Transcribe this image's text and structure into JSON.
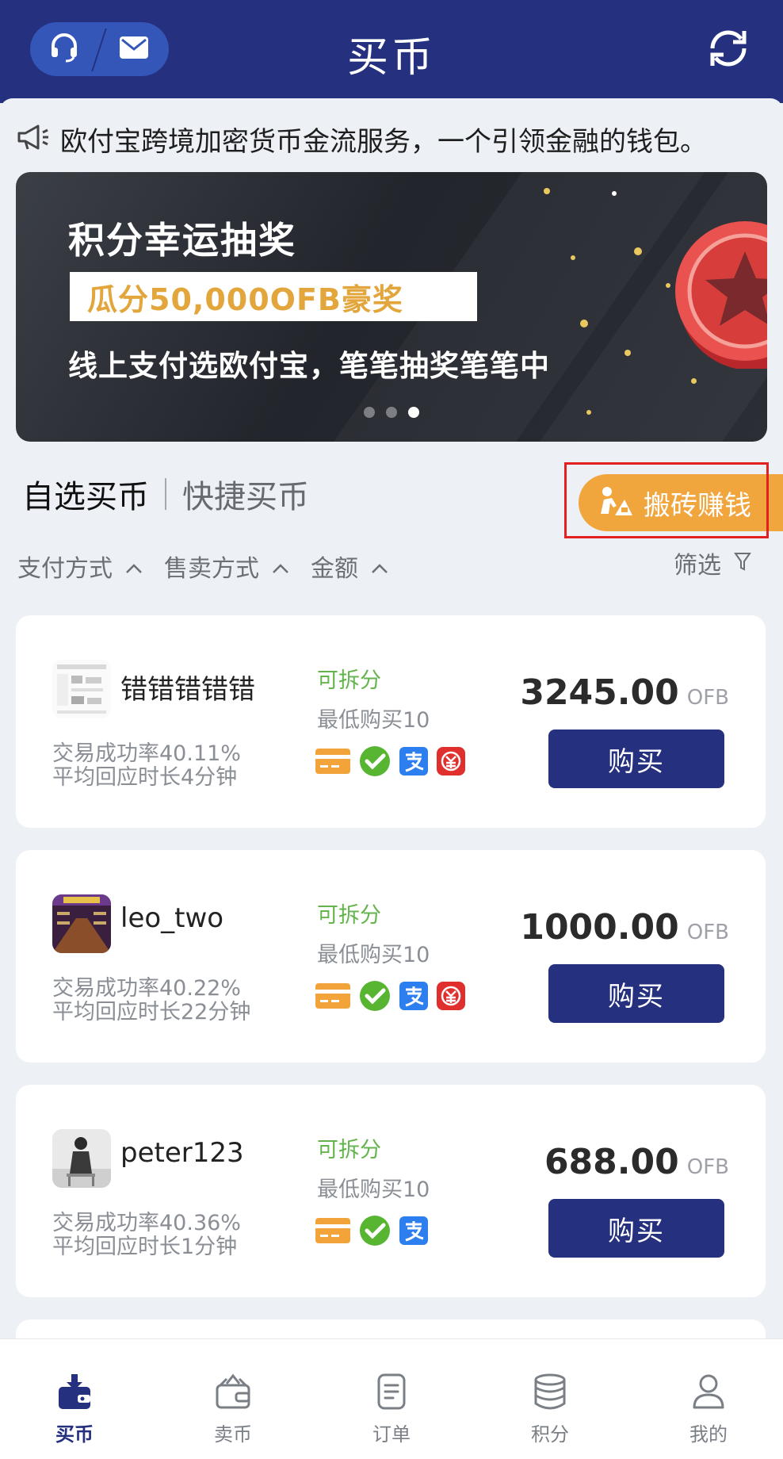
{
  "header": {
    "title": "买币",
    "support_icon": "headset-icon",
    "mail_icon": "mail-icon",
    "refresh_icon": "refresh-icon"
  },
  "notice": {
    "icon": "megaphone-icon",
    "text": "欧付宝跨境加密货币金流服务，一个引领金融的钱包。"
  },
  "banner": {
    "title": "积分幸运抽奖",
    "prize": "瓜分50,000OFB豪奖",
    "subtitle": "线上支付选欧付宝，笔笔抽奖笔笔中",
    "slide_count": 3,
    "active_slide": 3
  },
  "tabs": [
    {
      "label": "自选买币",
      "active": true
    },
    {
      "label": "快捷买币",
      "active": false
    }
  ],
  "earn_button": {
    "label": "搬砖赚钱",
    "icon": "worker-icon"
  },
  "filters": [
    {
      "label": "支付方式"
    },
    {
      "label": "售卖方式"
    },
    {
      "label": "金额"
    }
  ],
  "filter_button": {
    "label": "筛选",
    "icon": "funnel-icon"
  },
  "listings": [
    {
      "seller": "错错错错错",
      "success_rate": "交易成功率40.11%",
      "avg_response": "平均回应时长4分钟",
      "splittable": "可拆分",
      "min_buy": "最低购买10",
      "price": "3245.00",
      "unit": "OFB",
      "buy_label": "购买",
      "pay_methods": [
        "bank-card-icon",
        "wechat-icon",
        "alipay-icon",
        "unionpay-icon"
      ]
    },
    {
      "seller": "leo_two",
      "success_rate": "交易成功率40.22%",
      "avg_response": "平均回应时长22分钟",
      "splittable": "可拆分",
      "min_buy": "最低购买10",
      "price": "1000.00",
      "unit": "OFB",
      "buy_label": "购买",
      "pay_methods": [
        "bank-card-icon",
        "wechat-icon",
        "alipay-icon",
        "unionpay-icon"
      ]
    },
    {
      "seller": "peter123",
      "success_rate": "交易成功率40.36%",
      "avg_response": "平均回应时长1分钟",
      "splittable": "可拆分",
      "min_buy": "最低购买10",
      "price": "688.00",
      "unit": "OFB",
      "buy_label": "购买",
      "pay_methods": [
        "bank-card-icon",
        "wechat-icon",
        "alipay-icon"
      ]
    }
  ],
  "bottom_nav": [
    {
      "label": "买币",
      "icon": "buy-coin-icon",
      "active": true
    },
    {
      "label": "卖币",
      "icon": "sell-coin-icon",
      "active": false
    },
    {
      "label": "订单",
      "icon": "order-icon",
      "active": false
    },
    {
      "label": "积分",
      "icon": "points-icon",
      "active": false
    },
    {
      "label": "我的",
      "icon": "profile-icon",
      "active": false
    }
  ],
  "colors": {
    "primary": "#25307f",
    "accent": "#f1a53d",
    "success": "#64b44c",
    "highlight_border": "#e32020"
  }
}
